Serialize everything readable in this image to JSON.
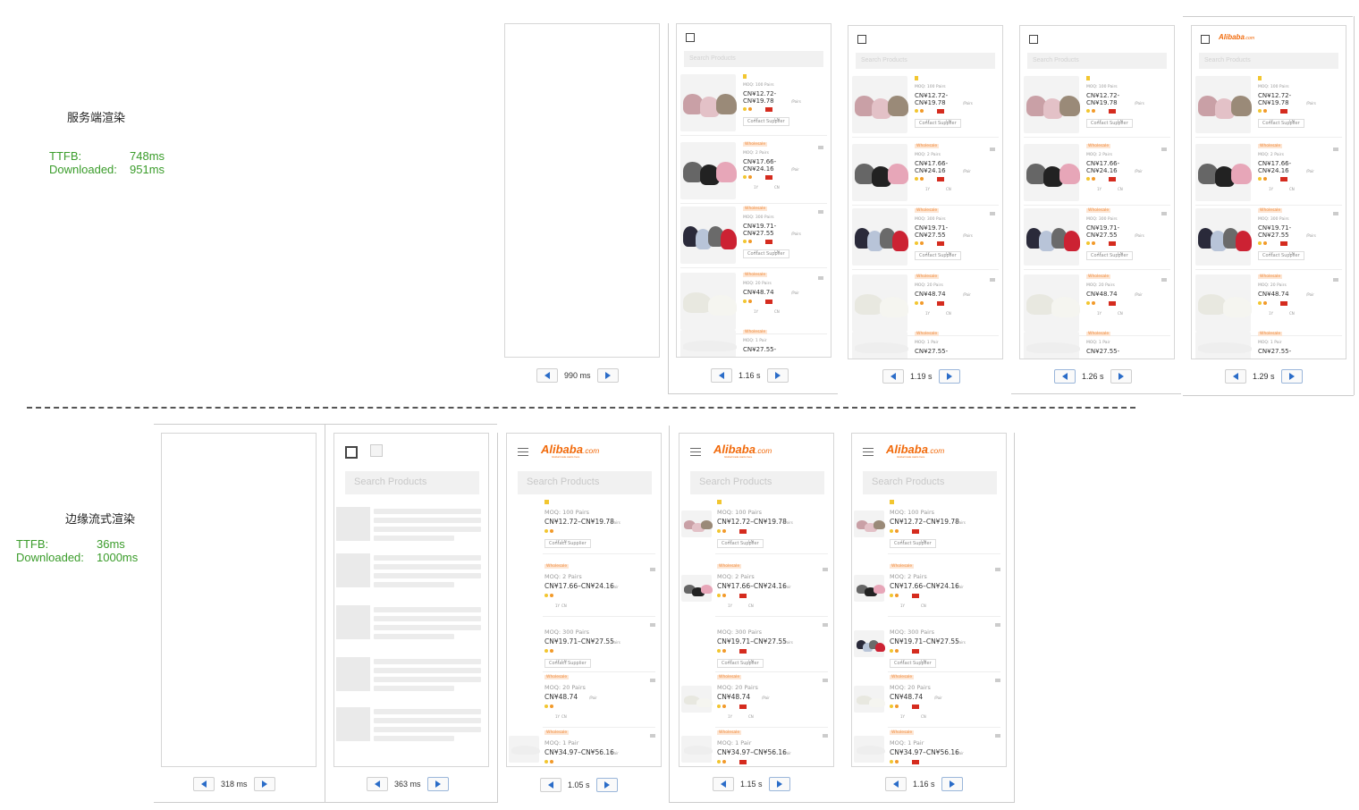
{
  "server": {
    "title": "服务端渲染",
    "ttfb_label": "TTFB:",
    "ttfb_value": "748ms",
    "downloaded_label": "Downloaded:",
    "downloaded_value": "951ms",
    "frames": [
      {
        "time": "990 ms",
        "state": "blank"
      },
      {
        "time": "1.16 s",
        "state": "content"
      },
      {
        "time": "1.19 s",
        "state": "content"
      },
      {
        "time": "1.26 s",
        "state": "content"
      },
      {
        "time": "1.29 s",
        "state": "logo"
      }
    ]
  },
  "edge": {
    "title": "边缘流式渲染",
    "ttfb_label": "TTFB:",
    "ttfb_value": "36ms",
    "downloaded_label": "Downloaded:",
    "downloaded_value": "1000ms",
    "frames": [
      {
        "time": "318 ms",
        "state": "blank"
      },
      {
        "time": "363 ms",
        "state": "skeleton"
      },
      {
        "time": "1.05 s",
        "state": "noimg"
      },
      {
        "time": "1.15 s",
        "state": "partial"
      },
      {
        "time": "1.16 s",
        "state": "full"
      }
    ]
  },
  "page": {
    "search_placeholder": "Search Products",
    "logo_text": "Alibaba",
    "logo_suffix": ".com",
    "logo_tagline": "Global trade starts here",
    "contact_label": "Contact Supplier",
    "wholesale_label": "Wholesale",
    "yr_label": "1Y",
    "country_label": "CN"
  },
  "products_small": [
    {
      "moq": "MOQ: 100 Pairs",
      "price1": "CN&yen;12.72-",
      "price2": "CN&yen;19.78",
      "unit": "/Pairs"
    },
    {
      "moq": "MOQ: 2 Pairs",
      "price1": "CN&yen;17.66-",
      "price2": "CN&yen;24.16",
      "unit": "/Pair"
    },
    {
      "moq": "MOQ: 300 Pairs",
      "price1": "CN&yen;19.71-",
      "price2": "CN&yen;27.55",
      "unit": "/Pairs"
    },
    {
      "moq": "MOQ: 20 Pairs",
      "price1": "CN&yen;48.74",
      "price2": "",
      "unit": "/Pair"
    },
    {
      "moq": "MOQ: 1 Pair",
      "price1": "CN&yen;27.55-",
      "price2": "",
      "unit": ""
    }
  ],
  "products_big": [
    {
      "moq": "MOQ: 100 Pairs",
      "price": "CN¥12.72–CN¥19.78",
      "unit": "/Pairs"
    },
    {
      "moq": "MOQ: 2 Pairs",
      "price": "CN¥17.66–CN¥24.16",
      "unit": "/Pair"
    },
    {
      "moq": "MOQ: 300 Pairs",
      "price": "CN¥19.71–CN¥27.55",
      "unit": "/Pairs"
    },
    {
      "moq": "MOQ: 20 Pairs",
      "price": "CN¥48.74",
      "unit": "/Pair"
    },
    {
      "moq": "MOQ: 1 Pair",
      "price": "CN¥34.97–CN¥56.16",
      "unit": "/Pair"
    }
  ],
  "colors": {
    "metric": "#3a9c2a",
    "brand": "#f16a0b",
    "nav": "#2a6cc8"
  }
}
